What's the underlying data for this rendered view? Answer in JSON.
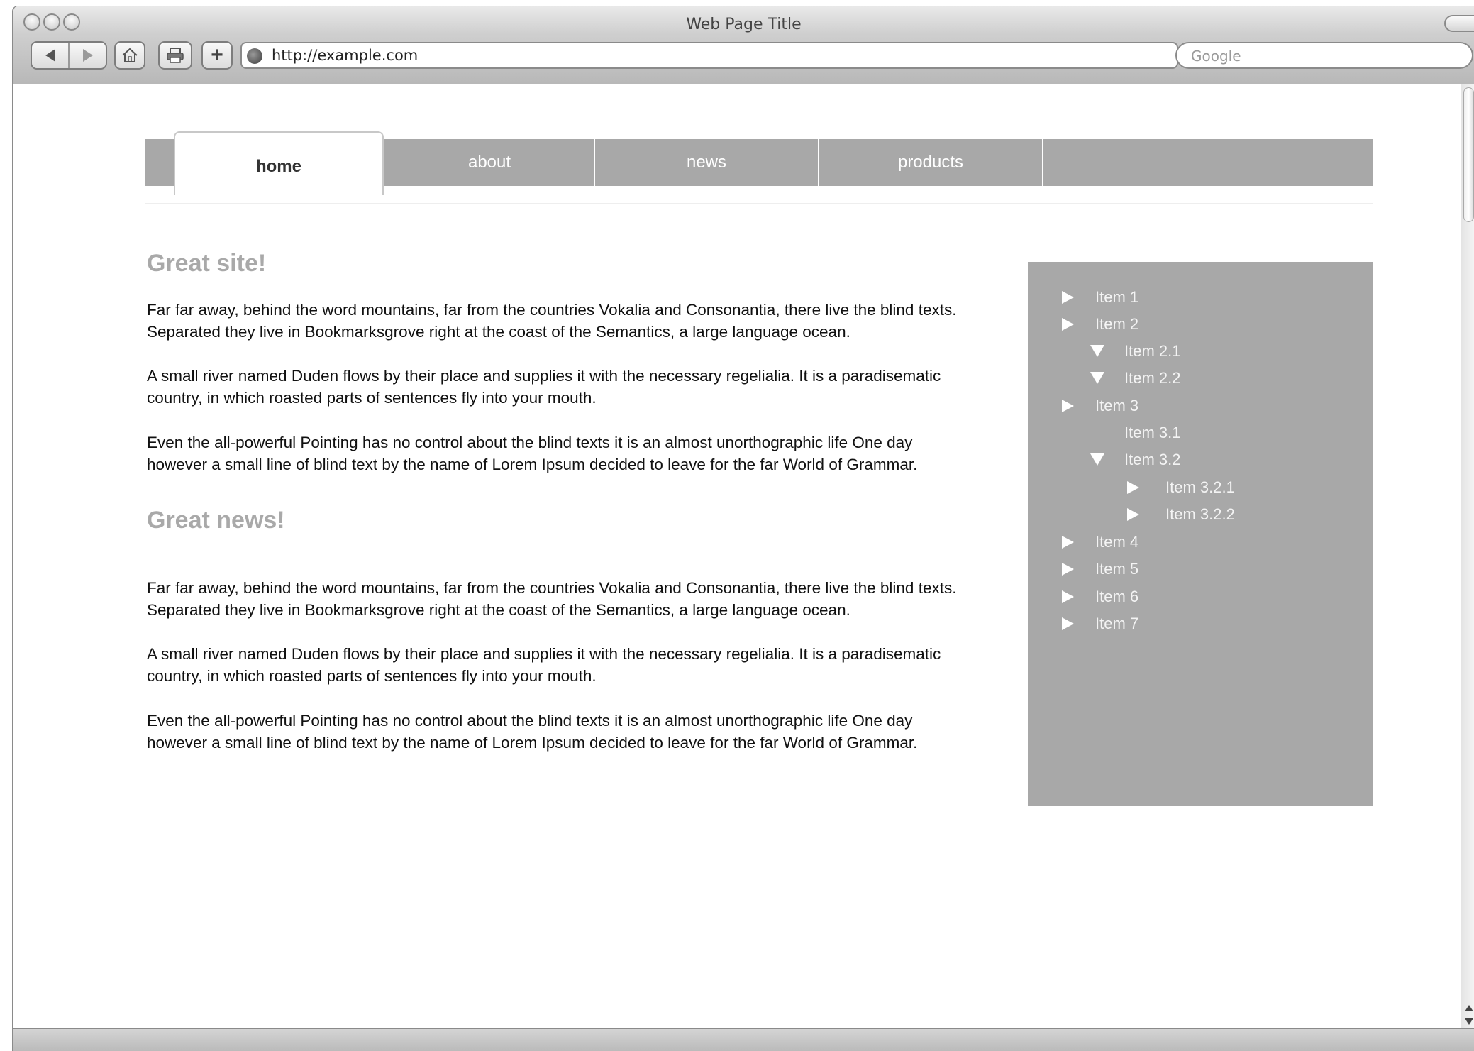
{
  "window": {
    "title": "Web Page Title"
  },
  "toolbar": {
    "address": "http://example.com",
    "search_placeholder": "Google",
    "add_symbol": "+"
  },
  "nav": {
    "tabs": [
      {
        "label": "home",
        "active": true
      },
      {
        "label": "about",
        "active": false
      },
      {
        "label": "news",
        "active": false
      },
      {
        "label": "products",
        "active": false
      }
    ]
  },
  "content": {
    "section1": {
      "heading": "Great site!",
      "paragraphs": [
        "Far far away, behind the word mountains, far from the countries Vokalia and Consonantia, there live the blind texts. Separated they live in Bookmarksgrove right at the coast of the Semantics, a large language ocean.",
        "A small river named Duden flows by their place and supplies it with the necessary regelialia. It is a paradisematic country, in which roasted parts of sentences fly into your mouth.",
        "Even the all-powerful Pointing has no control about the blind texts it is an almost unorthographic life One day however a small line of blind text by the name of Lorem Ipsum decided to leave for the far World of Grammar."
      ]
    },
    "section2": {
      "heading": "Great news!",
      "paragraphs": [
        "Far far away, behind the word mountains, far from the countries Vokalia and Consonantia, there live the blind texts. Separated they live in Bookmarksgrove right at the coast of the Semantics, a large language ocean.",
        "A small river named Duden flows by their place and supplies it with the necessary regelialia. It is a paradisematic country, in which roasted parts of sentences fly into your mouth.",
        "Even the all-powerful Pointing has no control about the blind texts it is an almost unorthographic life One day however a small line of blind text by the name of Lorem Ipsum decided to leave for the far World of Grammar."
      ]
    }
  },
  "sidebar": {
    "items": [
      {
        "label": "Item 1",
        "arrow": "right"
      },
      {
        "label": "Item 2",
        "arrow": "right"
      },
      {
        "label": "Item 2.1",
        "arrow": "down"
      },
      {
        "label": "Item 2.2",
        "arrow": "down"
      },
      {
        "label": "Item 3",
        "arrow": "right"
      },
      {
        "label": "Item 3.1",
        "arrow": "none"
      },
      {
        "label": "Item 3.2",
        "arrow": "down"
      },
      {
        "label": "Item 3.2.1",
        "arrow": "right"
      },
      {
        "label": "Item 3.2.2",
        "arrow": "right"
      },
      {
        "label": "Item 4",
        "arrow": "right"
      },
      {
        "label": "Item 5",
        "arrow": "right"
      },
      {
        "label": "Item 6",
        "arrow": "right"
      },
      {
        "label": "Item 7",
        "arrow": "right"
      }
    ]
  },
  "colors": {
    "tab_bar": "#a8a8a8",
    "sidebar": "#a8a8a8",
    "heading": "#a9a9a9"
  }
}
